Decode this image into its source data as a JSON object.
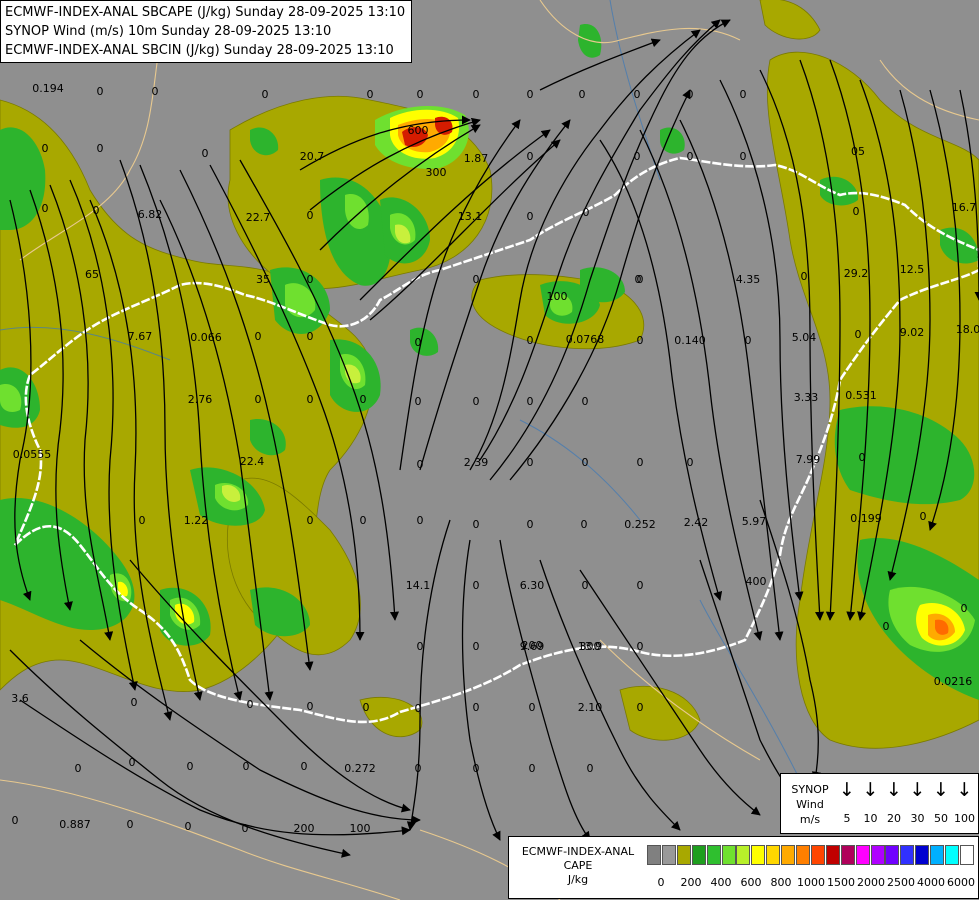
{
  "title": {
    "line1": "ECMWF-INDEX-ANAL SBCAPE (J/kg) Sunday 28-09-2025 13:10",
    "line2": "SYNOP Wind (m/s) 10m Sunday 28-09-2025 13:10",
    "line3": "ECMWF-INDEX-ANAL SBCIN (J/kg) Sunday 28-09-2025 13:10"
  },
  "colors": {
    "background": "#8f8f8f",
    "cape_low": "#a8a800",
    "cape_green": "#2db42d",
    "cape_bright_green": "#6fe02f",
    "cape_yellow_green": "#c8f03c",
    "cape_yellow": "#ffff00",
    "cape_orange": "#ff8c00",
    "cape_red": "#d41c00",
    "border": "#ffffff",
    "streamline": "#000000"
  },
  "map_labels": [
    {
      "text": "0.194"
    },
    {
      "text": "0"
    },
    {
      "text": "0"
    },
    {
      "text": "0"
    },
    {
      "text": "0"
    },
    {
      "text": "0"
    },
    {
      "text": "0"
    },
    {
      "text": "0"
    },
    {
      "text": "0"
    },
    {
      "text": "0"
    },
    {
      "text": "0"
    },
    {
      "text": "0"
    },
    {
      "text": "20.7"
    },
    {
      "text": "600"
    },
    {
      "text": "300"
    },
    {
      "text": "1.87"
    },
    {
      "text": "0"
    },
    {
      "text": "0"
    },
    {
      "text": "0"
    },
    {
      "text": "0"
    },
    {
      "text": "0"
    },
    {
      "text": "0"
    },
    {
      "text": "0"
    },
    {
      "text": "05"
    },
    {
      "text": "6.82"
    },
    {
      "text": "22.7"
    },
    {
      "text": "0"
    },
    {
      "text": "0"
    },
    {
      "text": "0"
    },
    {
      "text": "0"
    },
    {
      "text": "0"
    },
    {
      "text": "16.7"
    },
    {
      "text": "13.1"
    },
    {
      "text": "0"
    },
    {
      "text": "0"
    },
    {
      "text": "35"
    },
    {
      "text": "0"
    },
    {
      "text": "0"
    },
    {
      "text": "65"
    },
    {
      "text": "100"
    },
    {
      "text": "0"
    },
    {
      "text": "4.35"
    },
    {
      "text": "0"
    },
    {
      "text": "29.2"
    },
    {
      "text": "12.5"
    },
    {
      "text": "7.67"
    },
    {
      "text": "0.066"
    },
    {
      "text": "0"
    },
    {
      "text": "0"
    },
    {
      "text": "0"
    },
    {
      "text": "0"
    },
    {
      "text": "0.0768"
    },
    {
      "text": "0"
    },
    {
      "text": "0.140"
    },
    {
      "text": "0"
    },
    {
      "text": "5.04"
    },
    {
      "text": "0"
    },
    {
      "text": "9.02"
    },
    {
      "text": "18.0"
    },
    {
      "text": "2.76"
    },
    {
      "text": "0"
    },
    {
      "text": "0"
    },
    {
      "text": "0"
    },
    {
      "text": "0"
    },
    {
      "text": "0"
    },
    {
      "text": "0"
    },
    {
      "text": "0"
    },
    {
      "text": "3.33"
    },
    {
      "text": "0.531"
    },
    {
      "text": "0.0555"
    },
    {
      "text": "22.4"
    },
    {
      "text": "0"
    },
    {
      "text": "2.39"
    },
    {
      "text": "0"
    },
    {
      "text": "0"
    },
    {
      "text": "0"
    },
    {
      "text": "0"
    },
    {
      "text": "7.99"
    },
    {
      "text": "0"
    },
    {
      "text": "0"
    },
    {
      "text": "1.22"
    },
    {
      "text": "0"
    },
    {
      "text": "0"
    },
    {
      "text": "0"
    },
    {
      "text": "0"
    },
    {
      "text": "0"
    },
    {
      "text": "0"
    },
    {
      "text": "0.252"
    },
    {
      "text": "2.42"
    },
    {
      "text": "5.97"
    },
    {
      "text": "0.199"
    },
    {
      "text": "0"
    },
    {
      "text": "14.1"
    },
    {
      "text": "0"
    },
    {
      "text": "6.30"
    },
    {
      "text": "0"
    },
    {
      "text": "400"
    },
    {
      "text": "0"
    },
    {
      "text": "0"
    },
    {
      "text": "0"
    },
    {
      "text": "0"
    },
    {
      "text": "9.69"
    },
    {
      "text": "13.9"
    },
    {
      "text": "0"
    },
    {
      "text": "200"
    },
    {
      "text": "300"
    },
    {
      "text": "0"
    },
    {
      "text": "0.0216"
    },
    {
      "text": "3.6"
    },
    {
      "text": "0"
    },
    {
      "text": "0"
    },
    {
      "text": "0"
    },
    {
      "text": "0"
    },
    {
      "text": "0"
    },
    {
      "text": "0"
    },
    {
      "text": "0"
    },
    {
      "text": "2.10"
    },
    {
      "text": "0"
    },
    {
      "text": "0"
    },
    {
      "text": "0"
    },
    {
      "text": "0"
    },
    {
      "text": "0"
    },
    {
      "text": "0"
    },
    {
      "text": "0.272"
    },
    {
      "text": "0"
    },
    {
      "text": "0"
    },
    {
      "text": "0"
    },
    {
      "text": "0"
    },
    {
      "text": "0"
    },
    {
      "text": "0.887"
    },
    {
      "text": "0"
    },
    {
      "text": "0"
    },
    {
      "text": "0"
    },
    {
      "text": "200"
    },
    {
      "text": "100"
    }
  ],
  "synop_legend": {
    "label_line1": "SYNOP",
    "label_line2": "Wind",
    "label_line3": "m/s",
    "arrow_glyph": "↓",
    "values": [
      "5",
      "10",
      "20",
      "30",
      "50",
      "100"
    ]
  },
  "cape_legend": {
    "label_line1": "ECMWF-INDEX-ANAL",
    "label_line2": "CAPE",
    "label_line3": "J/kg",
    "swatch_colors": [
      "#808080",
      "#999999",
      "#a8a800",
      "#1e9e1e",
      "#2fbf2f",
      "#6fe02f",
      "#b8f02a",
      "#ffff00",
      "#ffd700",
      "#ffaa00",
      "#ff7f00",
      "#ff4500",
      "#c00000",
      "#b0005a",
      "#ff00ff",
      "#b000ff",
      "#7000ff",
      "#3030ff",
      "#0000d0",
      "#00b0ff",
      "#00ffff",
      "#ffffff"
    ],
    "ticks": [
      "0",
      "200",
      "400",
      "600",
      "800",
      "1000",
      "1500",
      "2000",
      "2500",
      "4000",
      "6000"
    ]
  }
}
